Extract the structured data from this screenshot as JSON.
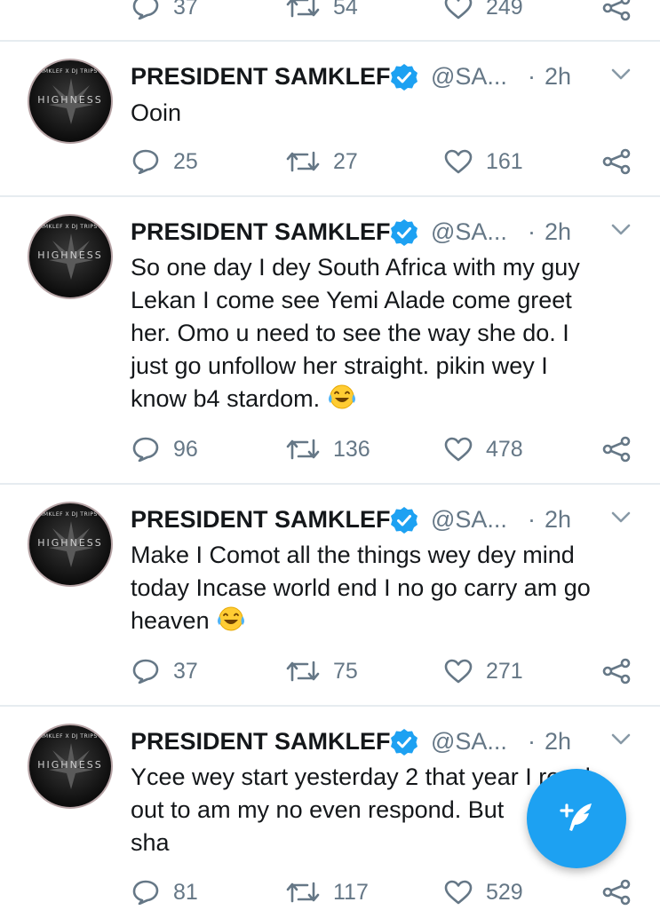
{
  "top_partial_tweet": {
    "reply_count": "37",
    "retweet_count": "54",
    "like_count": "249"
  },
  "tweets": [
    {
      "name": "PRESIDENT SAMKLEF",
      "handle": "@SA...",
      "dot": "·",
      "time": "2h",
      "text": "Ooin",
      "reply_count": "25",
      "retweet_count": "27",
      "like_count": "161"
    },
    {
      "name": "PRESIDENT SAMKLEF",
      "handle": "@SA...",
      "dot": "·",
      "time": "2h",
      "text": "So one day I dey South Africa with my guy\nLekan I come see Yemi Alade come greet\nher. Omo u need to see the way she do. I\njust go unfollow her straight. pikin wey I\nknow b4 stardom.",
      "reply_count": "96",
      "retweet_count": "136",
      "like_count": "478"
    },
    {
      "name": "PRESIDENT SAMKLEF",
      "handle": "@SA...",
      "dot": "·",
      "time": "2h",
      "text": "Make I Comot all the things wey dey mind\ntoday Incase world end I no go carry am go\nheaven",
      "reply_count": "37",
      "retweet_count": "75",
      "like_count": "271"
    },
    {
      "name": "PRESIDENT SAMKLEF",
      "handle": "@SA...",
      "dot": "·",
      "time": "2h",
      "text": "Ycee wey start yesterday 2 that year I reach\nout to am my no even respond. But\nsha",
      "reply_count": "81",
      "retweet_count": "117",
      "like_count": "529"
    }
  ],
  "avatar": {
    "ring_text": "SAMKLEF X DJ TRIPSTA",
    "logo_text": "HIGHNESS"
  },
  "icons": {
    "reply": "reply-icon",
    "retweet": "retweet-icon",
    "like": "heart-icon",
    "share": "share-icon",
    "verified": "verified-badge-icon",
    "menu": "chevron-down-icon",
    "compose": "compose-tweet-icon",
    "emoji": "face-with-tears-of-joy-emoji"
  },
  "colors": {
    "brand": "#1da1f2",
    "secondary_text": "#657786",
    "divider": "#e6ecf0"
  }
}
